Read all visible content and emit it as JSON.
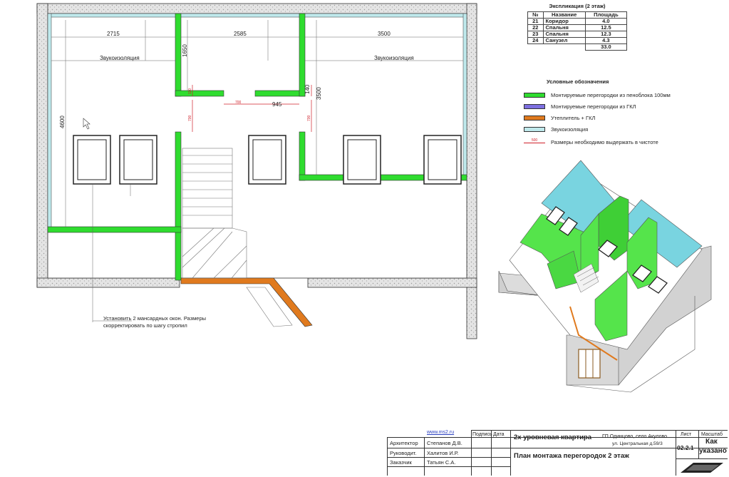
{
  "colors": {
    "foam_block": "#2fdc2f",
    "gkl": "#7d6fe0",
    "insulation": "#e07a1e",
    "soundproof": "#bfe9ec",
    "dimension_red": "#d0202a"
  },
  "plan": {
    "dimensions": {
      "d2715": "2715",
      "d2585": "2585",
      "d3500": "3500",
      "d1650": "1650",
      "d4600": "4600",
      "d3500v": "3500",
      "d945": "945",
      "d700a": "700",
      "d700b": "700",
      "d700c": "700",
      "d140": "140",
      "d110": "110"
    },
    "sound_label_left": "Звукоизоляция",
    "sound_label_right": "Звукоизоляция",
    "note_line1": "Установить 2 мансардных окон. Размеры",
    "note_line2": "скорректировать по шагу стропил"
  },
  "explication": {
    "title": "Экспликация (2 этаж)",
    "headers": [
      "№",
      "Название",
      "Площадь"
    ],
    "rows": [
      {
        "no": "21",
        "name": "Коридор",
        "area": "4.0"
      },
      {
        "no": "22",
        "name": "Спальня",
        "area": "12.5"
      },
      {
        "no": "23",
        "name": "Спальня",
        "area": "12.3"
      },
      {
        "no": "24",
        "name": "Санузел",
        "area": "4.3"
      }
    ],
    "total": "33.0"
  },
  "legend": {
    "title": "Условные обозначения",
    "items": [
      {
        "label": "Монтируемые перегородки из пеноблока 100мм",
        "color": "#2fdc2f"
      },
      {
        "label": "Монтируемые перегородки из ГКЛ",
        "color": "#7d6fe0"
      },
      {
        "label": "Утеплитель + ГКЛ",
        "color": "#e07a1e"
      },
      {
        "label": "Звукоизоляция",
        "color": "#bfe9ec"
      }
    ],
    "dim_sample": "500",
    "dim_label": "Размеры необходимо выдержать в чистоте"
  },
  "stamp": {
    "website": "www.ms2.ru",
    "col_sign": "Подпись",
    "col_date": "Дата",
    "roles": [
      {
        "role": "Архитектор",
        "name": "Степанов Д.В."
      },
      {
        "role": "Руководит.",
        "name": "Халитов И.Р."
      },
      {
        "role": "Заказчик",
        "name": "Татьян С.А."
      }
    ],
    "project_title": "2х уровневая квартира",
    "address_line1": "ГП Одинцово, село Акулово",
    "address_line2": "ул. Центральная д.59/3",
    "sheet_title": "План монтажа перегородок 2 этаж",
    "sheet_label": "Лист",
    "sheet_no": "02.2.1",
    "scale_label": "Масштаб",
    "scale_value_1": "Как",
    "scale_value_2": "указано"
  }
}
